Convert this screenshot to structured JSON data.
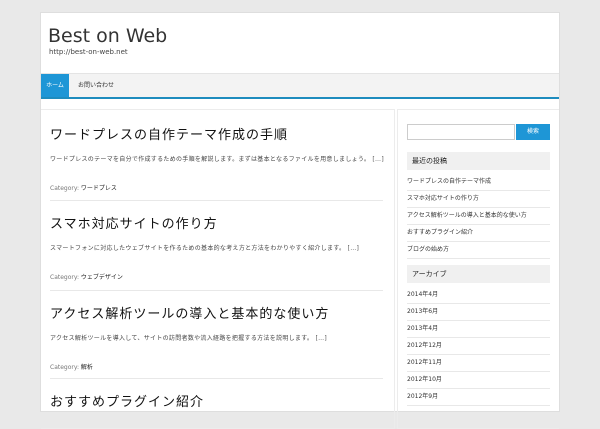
{
  "site": {
    "title": "Best on Web",
    "description": "http://best-on-web.net"
  },
  "nav": {
    "items": [
      {
        "label": "ホーム",
        "active": true
      },
      {
        "label": "お問い合わせ",
        "active": false
      }
    ]
  },
  "posts": [
    {
      "title": "ワードプレスの自作テーマ作成の手順",
      "excerpt": "ワードプレスのテーマを自分で作成するための手順を解説します。まずは基本となるファイルを用意しましょう。",
      "more": "[…]",
      "category_label": "Category:",
      "category": "ワードプレス"
    },
    {
      "title": "スマホ対応サイトの作り方",
      "excerpt": "スマートフォンに対応したウェブサイトを作るための基本的な考え方と方法をわかりやすく紹介します。",
      "more": "[…]",
      "category_label": "Category:",
      "category": "ウェブデザイン"
    },
    {
      "title": "アクセス解析ツールの導入と基本的な使い方",
      "excerpt": "アクセス解析ツールを導入して、サイトの訪問者数や流入経路を把握する方法を説明します。",
      "more": "[…]",
      "category_label": "Category:",
      "category": "解析"
    },
    {
      "title": "おすすめプラグイン紹介"
    }
  ],
  "sidebar": {
    "search_button": "検索",
    "search_placeholder": "",
    "recent_title": "最近の投稿",
    "recent_posts": [
      "ワードプレスの自作テーマ作成",
      "スマホ対応サイトの作り方",
      "アクセス解析ツールの導入と基本的な使い方",
      "おすすめプラグイン紹介",
      "ブログの始め方"
    ],
    "archive_title": "アーカイブ",
    "archives": [
      "2014年4月",
      "2013年6月",
      "2013年4月",
      "2012年12月",
      "2012年11月",
      "2012年10月",
      "2012年9月"
    ]
  },
  "colors": {
    "accent": "#1e96d6",
    "nav_bar": "#1e8cbe",
    "background": "#e9e9e9"
  }
}
